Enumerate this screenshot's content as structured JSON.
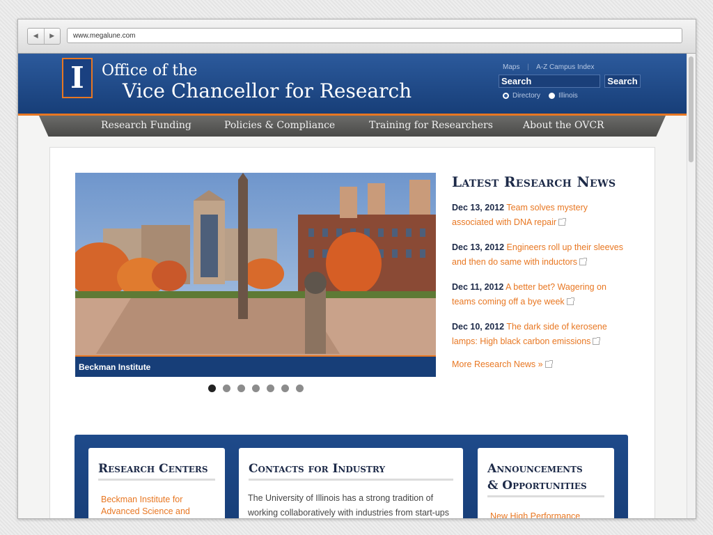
{
  "browser": {
    "url": "www.megalune.com",
    "back_icon": "◀",
    "forward_icon": "▶"
  },
  "header": {
    "logo_mark": "I",
    "title_line1": "Office of the",
    "title_line2": "Vice Chancellor for Research",
    "util_links": [
      "Maps",
      "A-Z Campus Index"
    ],
    "search": {
      "value": "Search",
      "button": "Search"
    },
    "radio_options": [
      "Directory",
      "Illinois"
    ],
    "colors": {
      "blue": "#173e78",
      "orange": "#e87722"
    }
  },
  "nav": [
    "Research Funding",
    "Policies & Compliance",
    "Training for Researchers",
    "About the OVCR"
  ],
  "slideshow": {
    "caption": "Beckman Institute",
    "dot_count": 7,
    "active": 0
  },
  "news": {
    "title": "Latest Research News",
    "items": [
      {
        "date": "Dec 13, 2012",
        "text": "Team solves mystery associated with DNA repair"
      },
      {
        "date": "Dec 13, 2012",
        "text": "Engineers roll up their sleeves and then do same with inductors"
      },
      {
        "date": "Dec 11, 2012",
        "text": "A better bet? Wagering on teams coming off a bye week"
      },
      {
        "date": "Dec 10, 2012",
        "text": "The dark side of kerosene lamps: High black carbon emissions"
      }
    ],
    "more": "More Research News »"
  },
  "sections": {
    "research_centers": {
      "title": "Research Centers",
      "link": "Beckman Institute for Advanced Science and Technology"
    },
    "contacts": {
      "title": "Contacts for Industry",
      "text": "The University of Illinois has a strong tradition of working collaboratively with industries from start-ups to industry leaders and provides an entrepreneurial"
    },
    "announcements": {
      "title_line1": "Announcements",
      "title_line2": "& Opportunities",
      "link": "New High Performance Biological Computing"
    }
  }
}
